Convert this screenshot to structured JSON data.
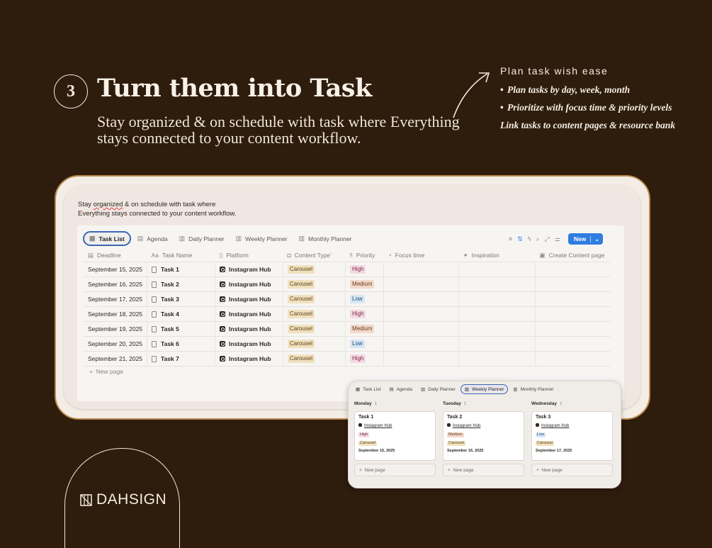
{
  "step_number": "3",
  "headline": "Turn them into Task",
  "subline": "Stay organized & on schedule with task where Everything stays connected to your content workflow.",
  "side": {
    "kicker": "Plan task wish ease",
    "bullets": [
      "Plan tasks by day, week, month",
      "Prioritize with focus time & priority levels"
    ],
    "footer": "Link tasks to content pages & resource bank"
  },
  "window": {
    "description_pre": "Stay ",
    "description_squiggle": "organized",
    "description_post": " & on schedule with task where Everything stays connected to your content workflow.",
    "tabs": [
      "Task List",
      "Agenda",
      "Daily Planner",
      "Weekly Planner",
      "Monthly Planner"
    ],
    "active_tab": "Task List",
    "new_button": "New",
    "columns": [
      "Deadline",
      "Task Name",
      "Platform",
      "Content Type`",
      "Priority",
      "Focus time",
      "Inspiration",
      "Create Content page"
    ],
    "rows": [
      {
        "deadline": "September 15, 2025",
        "task": "Task 1",
        "platform": "Instagram Hub",
        "type": "Carousel",
        "priority": "High"
      },
      {
        "deadline": "September 16, 2025",
        "task": "Task 2",
        "platform": "Instagram Hub",
        "type": "Carousel",
        "priority": "Medium"
      },
      {
        "deadline": "September 17, 2025",
        "task": "Task 3",
        "platform": "Instagram Hub",
        "type": "Carousel",
        "priority": "Low"
      },
      {
        "deadline": "September 18, 2025",
        "task": "Task 4",
        "platform": "Instagram Hub",
        "type": "Carousel",
        "priority": "High"
      },
      {
        "deadline": "September 19, 2025",
        "task": "Task 5",
        "platform": "Instagram Hub",
        "type": "Carousel",
        "priority": "Medium"
      },
      {
        "deadline": "September 20, 2025",
        "task": "Task 6",
        "platform": "Instagram Hub",
        "type": "Carousel",
        "priority": "Low"
      },
      {
        "deadline": "September 21, 2025",
        "task": "Task 7",
        "platform": "Instagram Hub",
        "type": "Carousel",
        "priority": "High"
      }
    ],
    "new_page": "New page"
  },
  "weekly": {
    "tabs": [
      "Task List",
      "Agenda",
      "Daily Planner",
      "Weekly Planner",
      "Monthly Planner"
    ],
    "active_tab": "Weekly Planner",
    "columns": [
      {
        "day": "Monday",
        "count": "1",
        "task": "Task 1",
        "platform": "Instagram Hub",
        "priority": "High",
        "type": "Carousel",
        "date": "September 15, 2025"
      },
      {
        "day": "Tuesday",
        "count": "1",
        "task": "Task 2",
        "platform": "Instagram Hub",
        "priority": "Medium",
        "type": "Carousel",
        "date": "September 16, 2025"
      },
      {
        "day": "Wednesday",
        "count": "1",
        "task": "Task 3",
        "platform": "Instagram Hub",
        "priority": "Low",
        "type": "Carousel",
        "date": "September 17, 2025"
      }
    ],
    "new_page": "New page"
  },
  "brand": "DAHSIGN",
  "colors": {
    "background": "#2e1c0d",
    "accent": "#2f7de1",
    "frame": "#b98a4f"
  }
}
